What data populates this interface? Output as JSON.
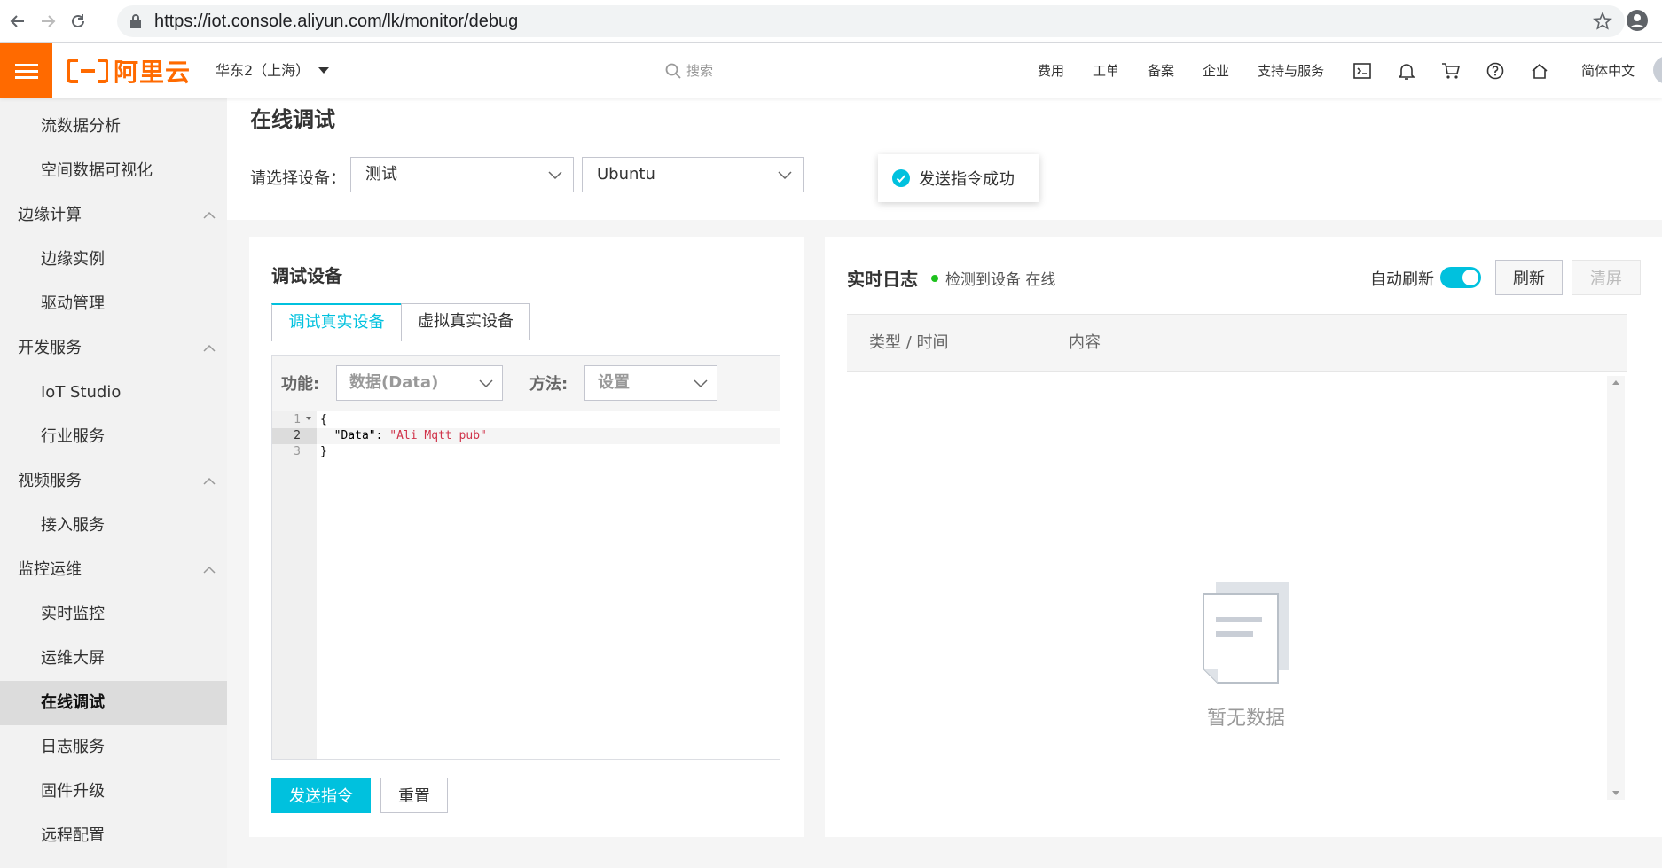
{
  "browser": {
    "url": "https://iot.console.aliyun.com/lk/monitor/debug"
  },
  "header": {
    "logo_text": "阿里云",
    "region": "华东2（上海）",
    "search_placeholder": "搜索",
    "links": [
      "费用",
      "工单",
      "备案",
      "企业",
      "支持与服务"
    ],
    "language": "简体中文",
    "brand_color": "#ff6a00"
  },
  "sidebar": {
    "items": [
      {
        "label": "流数据分析",
        "type": "child"
      },
      {
        "label": "空间数据可视化",
        "type": "child"
      },
      {
        "label": "边缘计算",
        "type": "group"
      },
      {
        "label": "边缘实例",
        "type": "child"
      },
      {
        "label": "驱动管理",
        "type": "child"
      },
      {
        "label": "开发服务",
        "type": "group"
      },
      {
        "label": "IoT Studio",
        "type": "child"
      },
      {
        "label": "行业服务",
        "type": "child"
      },
      {
        "label": "视频服务",
        "type": "group"
      },
      {
        "label": "接入服务",
        "type": "child"
      },
      {
        "label": "监控运维",
        "type": "group"
      },
      {
        "label": "实时监控",
        "type": "child"
      },
      {
        "label": "运维大屏",
        "type": "child"
      },
      {
        "label": "在线调试",
        "type": "child",
        "active": true
      },
      {
        "label": "日志服务",
        "type": "child"
      },
      {
        "label": "固件升级",
        "type": "child"
      },
      {
        "label": "远程配置",
        "type": "child"
      }
    ]
  },
  "page": {
    "title": "在线调试",
    "select_label": "请选择设备：",
    "product_select": "测试",
    "device_select": "Ubuntu"
  },
  "toast": {
    "message": "发送指令成功"
  },
  "debug_panel": {
    "title": "调试设备",
    "tabs": [
      "调试真实设备",
      "虚拟真实设备"
    ],
    "function_label": "功能:",
    "function_value": "数据(Data)",
    "method_label": "方法:",
    "method_value": "设置",
    "code": {
      "line_numbers": [
        "1",
        "2",
        "3"
      ],
      "line1": "{",
      "line2_key": "  \"Data\": ",
      "line2_value": "\"Ali Mqtt pub\"",
      "line3": "}"
    },
    "send_button": "发送指令",
    "reset_button": "重置"
  },
  "log_panel": {
    "title": "实时日志",
    "status": "检测到设备 在线",
    "auto_refresh_label": "自动刷新",
    "refresh_button": "刷新",
    "clear_button": "清屏",
    "columns": [
      "类型 / 时间",
      "内容"
    ],
    "empty_text": "暂无数据"
  },
  "colors": {
    "accent": "#00c1de",
    "online": "#1dc11d"
  }
}
